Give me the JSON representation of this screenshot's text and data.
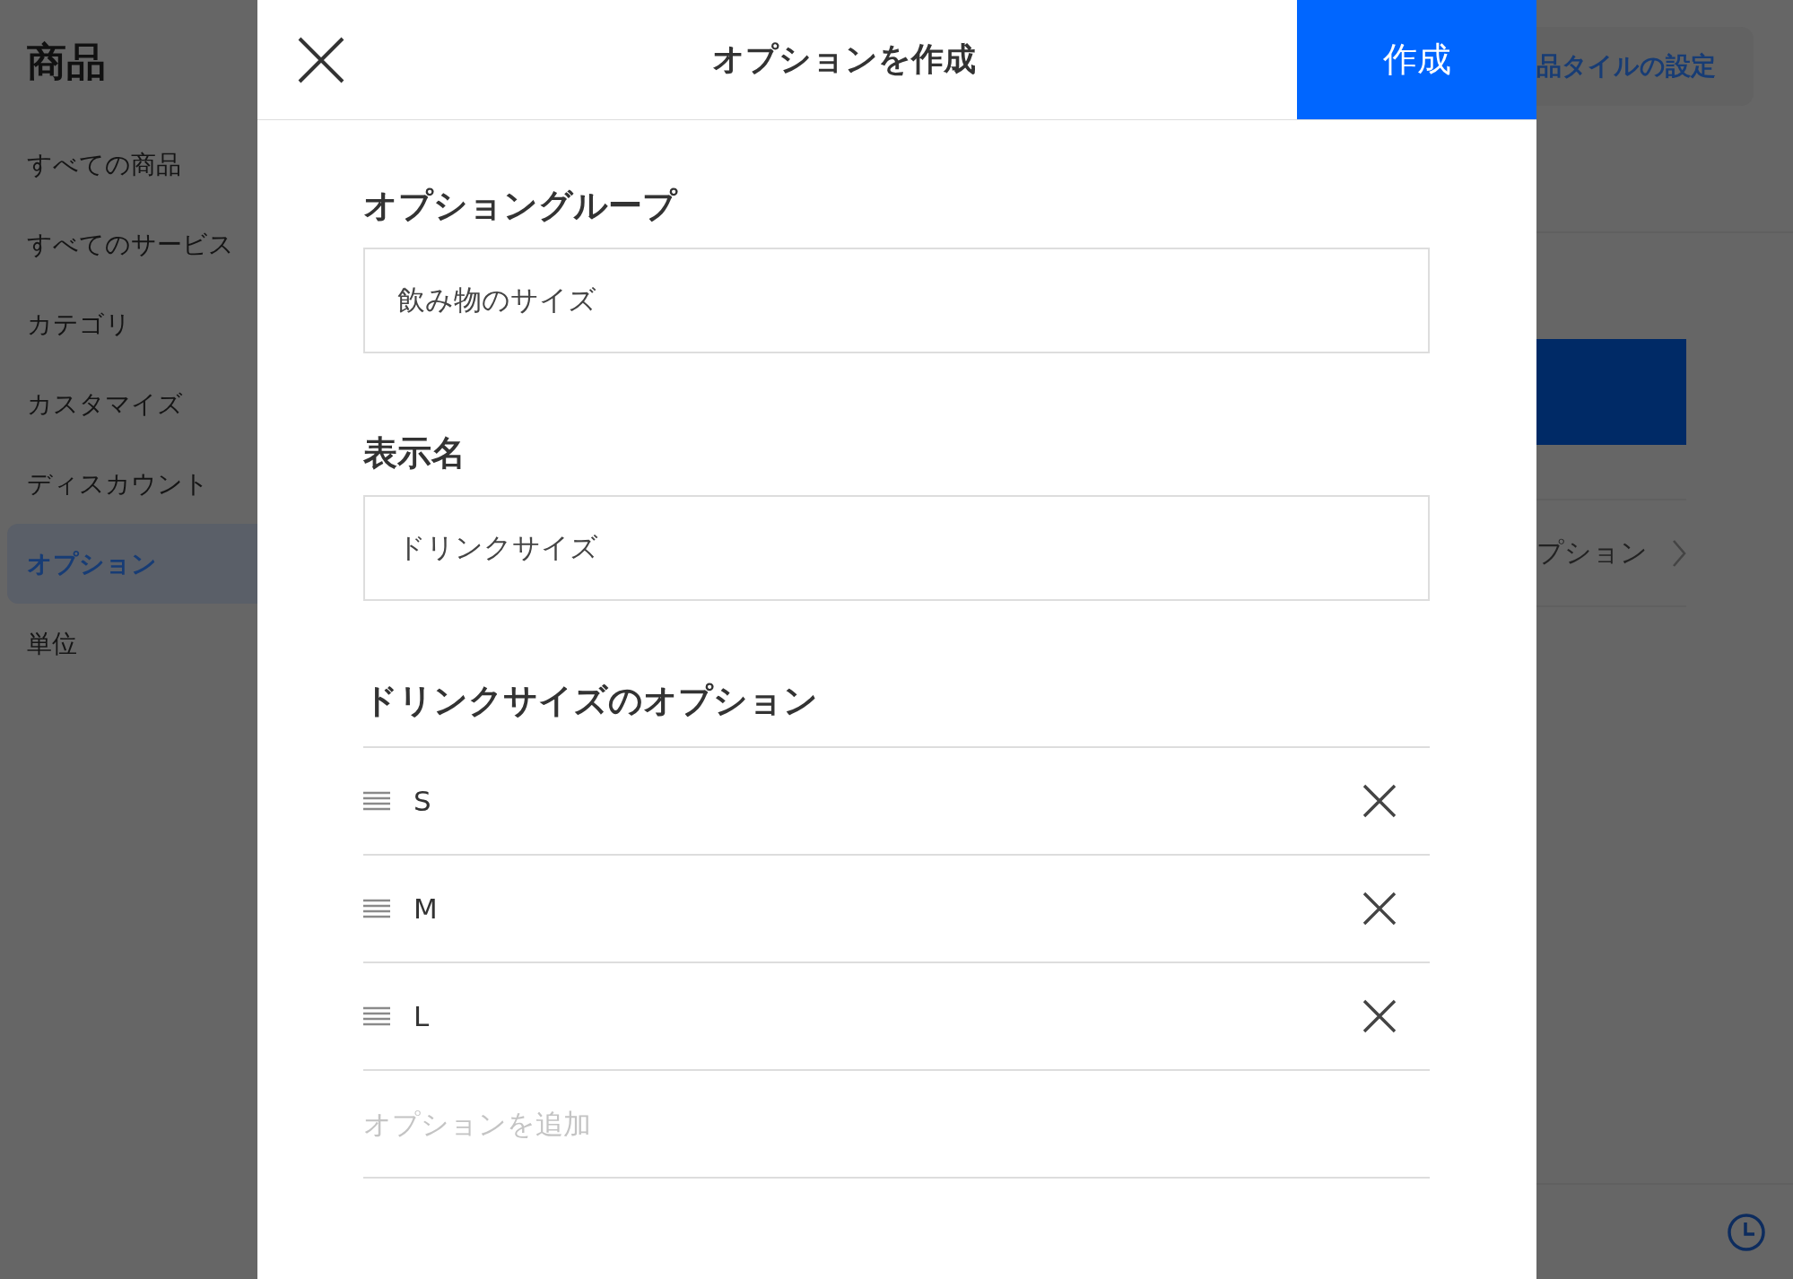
{
  "sidebar": {
    "title": "商品",
    "items": [
      {
        "label": "すべての商品",
        "selected": false
      },
      {
        "label": "すべてのサービス",
        "selected": false
      },
      {
        "label": "カテゴリ",
        "selected": false
      },
      {
        "label": "カスタマイズ",
        "selected": false
      },
      {
        "label": "ディスカウント",
        "selected": false
      },
      {
        "label": "オプション",
        "selected": true
      },
      {
        "label": "単位",
        "selected": false
      }
    ]
  },
  "dialog": {
    "title": "オプションを作成",
    "create_button": "作成",
    "fields": [
      {
        "label": "オプショングループ",
        "value": "飲み物のサイズ"
      },
      {
        "label": "表示名",
        "value": "ドリンクサイズ"
      }
    ],
    "options_heading": "ドリンクサイズのオプション",
    "options": [
      {
        "label": "S"
      },
      {
        "label": "M"
      },
      {
        "label": "L"
      }
    ],
    "add_option": {
      "placeholder": "オプションを追加"
    }
  },
  "background": {
    "tile_settings_button": "品タイルの設定",
    "list_item": "プション"
  }
}
